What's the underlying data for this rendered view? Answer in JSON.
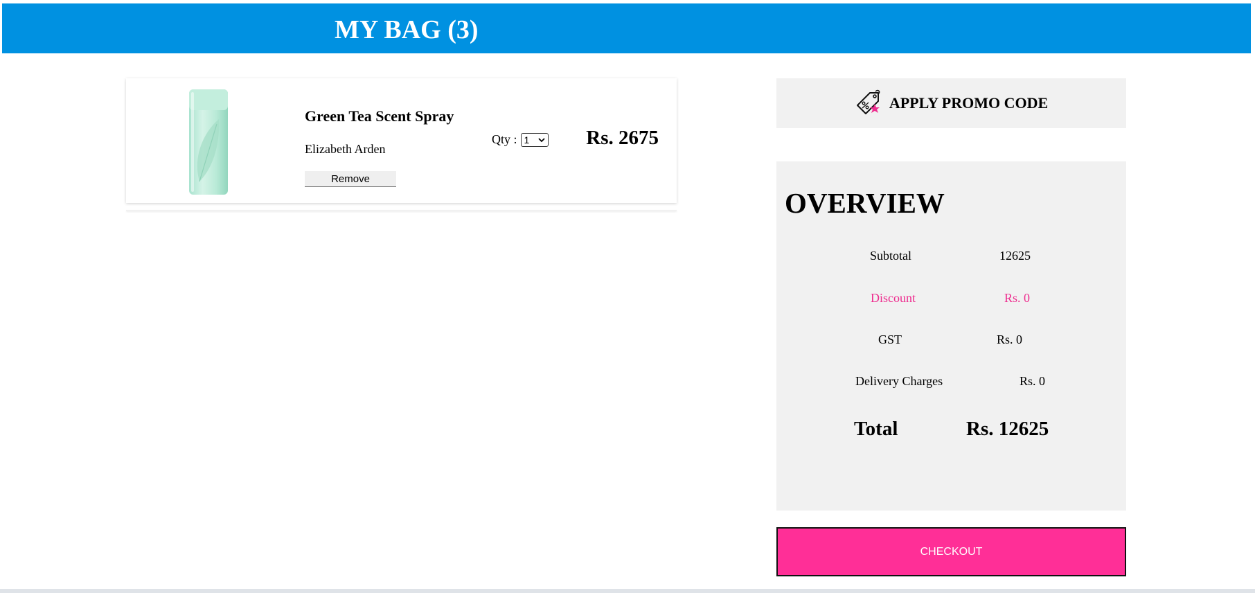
{
  "header": {
    "title": "MY BAG (3)",
    "background_color": "#0091e1"
  },
  "cart": {
    "items": [
      {
        "name": "Green Tea Scent Spray",
        "brand": "Elizabeth Arden",
        "remove_label": "Remove",
        "qty_label": "Qty :",
        "qty_value": "1",
        "price": "Rs. 2675",
        "image_icon": "perfume-bottle-image"
      }
    ]
  },
  "promo": {
    "label": "APPLY PROMO CODE",
    "icon": "discount-tag-icon"
  },
  "overview": {
    "title": "OVERVIEW",
    "subtotal_label": "Subtotal",
    "subtotal_value": "12625",
    "discount_label": "Discount",
    "discount_value": "Rs. 0",
    "gst_label": "GST",
    "gst_value": "Rs. 0",
    "delivery_label": "Delivery Charges",
    "delivery_value": "Rs. 0",
    "total_label": "Total",
    "total_value": "Rs. 12625"
  },
  "checkout": {
    "label": "CHECKOUT",
    "color": "#ff2f97"
  },
  "accent_colors": {
    "pink": "#ee2d8f",
    "panel_gray": "#f1f1f1"
  }
}
